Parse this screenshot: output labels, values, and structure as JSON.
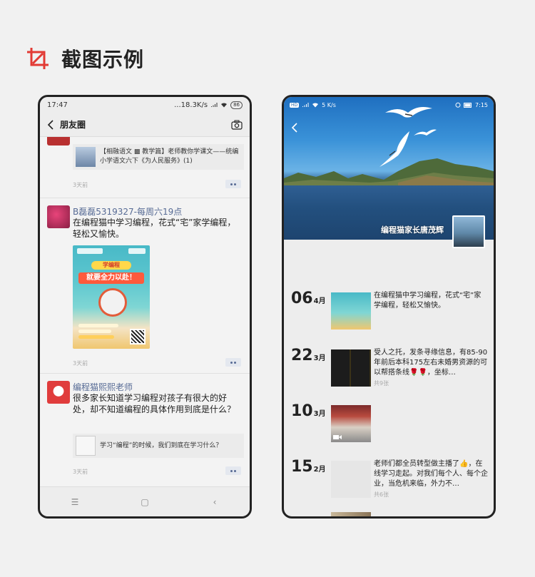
{
  "header": {
    "title": "截图示例",
    "accent": "#e23a34"
  },
  "left_phone": {
    "status": {
      "time": "17:47",
      "network": "...18.3K/s",
      "battery": "86"
    },
    "nav": {
      "title": "朋友圈"
    },
    "posts": [
      {
        "link_text": "【相融语文 ▩ 教学篇】老师教你学课文——统编小学语文六下《为人民服务》(1)",
        "time": "3天前"
      },
      {
        "name": "B磊磊5319327-每周六19点",
        "text": "在编程猫中学习编程，花式“宅”家学编程，轻松又愉快。",
        "poster_tag": "学编程",
        "poster_headline": "就要全力以赴！",
        "time": "3天前"
      },
      {
        "name": "编程猫熙熙老师",
        "text": "很多家长知道学习编程对孩子有很大的好处，却不知道编程的具体作用到底是什么？",
        "link_text": "学习“编程”的时候，我们到底在学习什么？",
        "time": "3天前"
      }
    ]
  },
  "right_phone": {
    "status": {
      "network": "5 K/s",
      "time": "7:15"
    },
    "owner_name": "编程猫家长唐茂辉",
    "timeline": [
      {
        "day": "06",
        "month": "4月",
        "text": "在编程猫中学习编程，花式“宅”家学编程，轻松又愉快。",
        "count": ""
      },
      {
        "day": "22",
        "month": "3月",
        "text": "受人之托，发条寻缘信息，有85-90年前后本科175左右未婚男资源的可以帮搭条线🌹🌹，坐标…",
        "count": "共9张"
      },
      {
        "day": "10",
        "month": "3月",
        "text": "",
        "count": ""
      },
      {
        "day": "15",
        "month": "2月",
        "text": "老师们都全员转型做主播了👍，在线学习走起。对我们每个人、每个企业，当危机来临，外力不…",
        "count": "共6张"
      }
    ]
  }
}
